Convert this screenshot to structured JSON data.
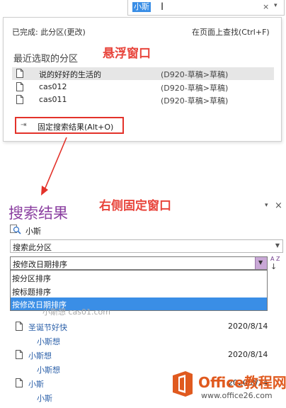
{
  "top_search": {
    "query": "小斯",
    "clear_glyph": "×",
    "dropdown_glyph": "▾"
  },
  "popup": {
    "status": "已完成: 此分区(更改)",
    "find_in_page": "在页面上查找(Ctrl+F)",
    "header": "最近选取的分区",
    "annotation": "悬浮窗口",
    "results": [
      {
        "name": "说的好好的生活的",
        "path": "(D920-草稿>草稿)"
      },
      {
        "name": "cas012",
        "path": "(D920-草稿>草稿)"
      },
      {
        "name": "cas011",
        "path": "(D920-草稿>草稿)"
      }
    ],
    "pin_label": "固定搜索结果(Alt+O)",
    "pin_glyph": "⇥"
  },
  "pane": {
    "title": "搜索结果",
    "annotation": "右侧固定窗口",
    "dropdown_glyph": "▾",
    "close_glyph": "×",
    "query": "小斯",
    "scope_value": "搜索此分区",
    "sort_value": "按修改日期排序",
    "sort_dir_az": "A Z",
    "sort_dir_arrow": "↓",
    "sort_options": [
      "按分区排序",
      "按标题排序",
      "按修改日期排序"
    ],
    "hidden_text": "小斯想  cas01.com",
    "items": [
      {
        "title": "圣诞节好快",
        "date": "2020/8/14",
        "section": "小斯想"
      },
      {
        "title": "小斯想",
        "date": "2020/8/14",
        "section": "小斯想"
      },
      {
        "title": "小斯",
        "date": "2020/8/14",
        "section": "小斯"
      }
    ]
  },
  "watermark": {
    "brand": "Office教程网",
    "url": "www.office26.com",
    "partial_text": "小斯想  cas01.com"
  },
  "colors": {
    "accent_red": "#e8453c",
    "title_purple": "#8a3ea0",
    "selection_blue": "#3a8ee6",
    "link_blue": "#2a5fa8"
  }
}
